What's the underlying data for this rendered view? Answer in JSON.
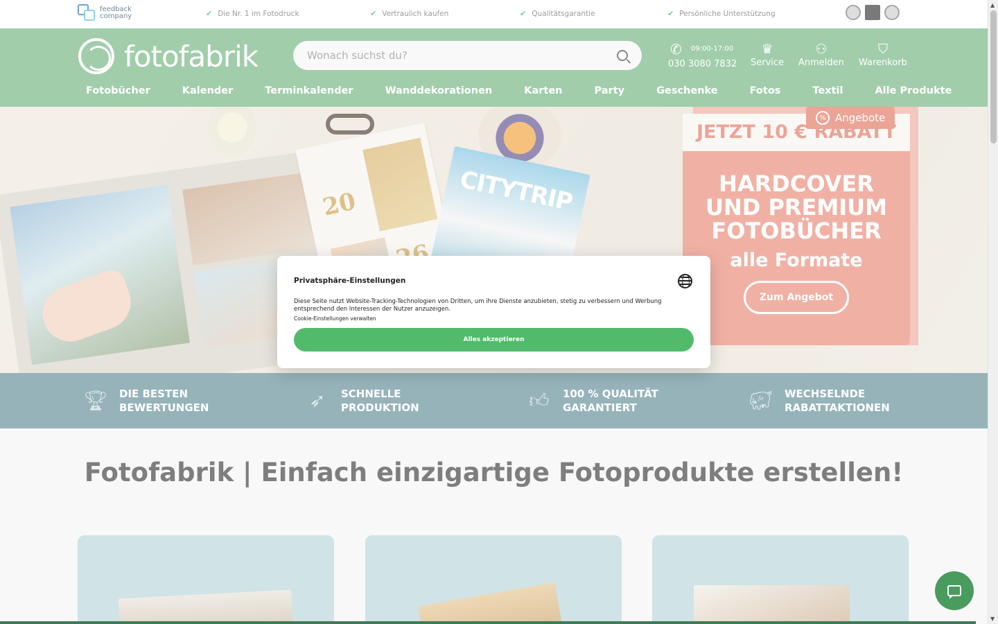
{
  "topbar": {
    "feedback_logo_line1": "feedback",
    "feedback_logo_line2": "company",
    "usps": [
      "Die Nr. 1 im Fotodruck",
      "Vertraulich kaufen",
      "Qualitätsgarantie",
      "Persönliche Unterstützung"
    ],
    "checkmark": "✔"
  },
  "header": {
    "logo_text": "fotofabrik",
    "search_placeholder": "Wonach suchst du?",
    "phone_hours": "09:00-17:00",
    "phone_number": "030 3080 7832",
    "service_label": "Service",
    "login_label": "Anmelden",
    "cart_label": "Warenkorb",
    "nav": [
      "Fotobücher",
      "Kalender",
      "Terminkalender",
      "Wanddekorationen",
      "Karten",
      "Party",
      "Geschenke",
      "Fotos",
      "Textil",
      "Alle Produkte"
    ]
  },
  "hero": {
    "book_year_top": "20",
    "book_year_bottom": "26",
    "book_title": "CITYTRIP",
    "promo_tag": "Angebote",
    "promo_banner": "JETZT 10 € RABATT",
    "promo_headline_1": "HARDCOVER",
    "promo_headline_2": "UND PREMIUM",
    "promo_headline_3": "FOTOBÜCHER",
    "promo_sub": "alle Formate",
    "promo_button": "Zum Angebot"
  },
  "features": [
    {
      "icon": "trophy-icon",
      "line1": "DIE BESTEN",
      "line2": "BEWERTUNGEN"
    },
    {
      "icon": "rocket-icon",
      "line1": "SCHNELLE",
      "line2": "PRODUKTION"
    },
    {
      "icon": "thumbs-up-icon",
      "line1": "100 % QUALITÄT",
      "line2": "GARANTIERT"
    },
    {
      "icon": "piggy-bank-icon",
      "line1": "WECHSELNDE",
      "line2": "RABATTAKTIONEN"
    }
  ],
  "main": {
    "title": "Fotofabrik | Einfach einzigartige Fotoprodukte erstellen!"
  },
  "cookie_dialog": {
    "title": "Privatsphäre-Einstellungen",
    "description": "Diese Seite nutzt Website-Tracking-Technologien von Dritten, um ihre Dienste anzubieten, stetig zu verbessern und Werbung entsprechend den Interessen der Nutzer anzuzeigen.",
    "manage_link": "Cookie-Einstellungen verwalten",
    "accept_button": "Alles akzeptieren"
  },
  "colors": {
    "brand_green": "#6fb37e",
    "accept_green": "#52ba6b",
    "promo_coral": "#e88874",
    "feature_bar": "#5e8a95"
  }
}
